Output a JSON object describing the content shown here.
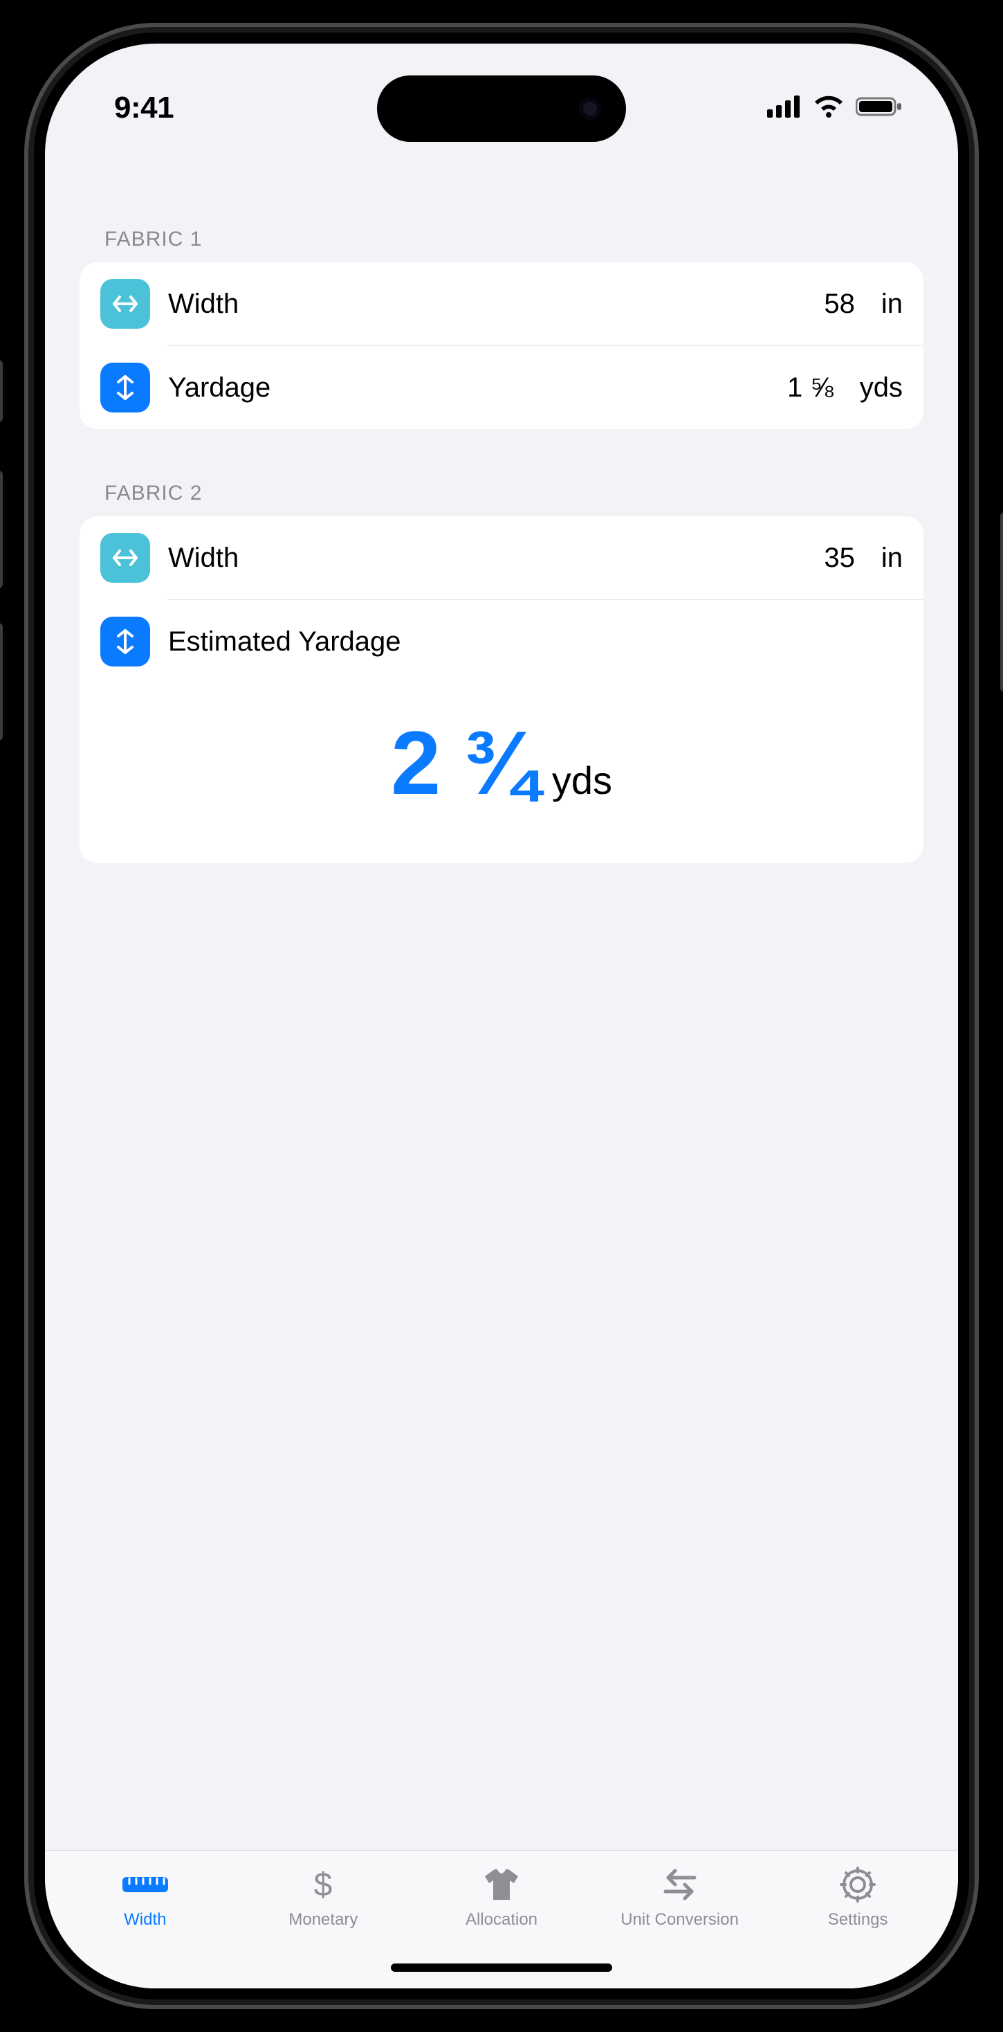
{
  "status": {
    "time": "9:41"
  },
  "sections": {
    "fabric1": {
      "title": "FABRIC 1",
      "width": {
        "label": "Width",
        "value": "58",
        "unit": "in"
      },
      "yardage": {
        "label": "Yardage",
        "value": "1 ⅝",
        "unit": "yds"
      }
    },
    "fabric2": {
      "title": "FABRIC 2",
      "width": {
        "label": "Width",
        "value": "35",
        "unit": "in"
      },
      "estimate": {
        "label": "Estimated Yardage",
        "value": "2 ¾",
        "unit": "yds"
      }
    }
  },
  "tabs": {
    "width": {
      "label": "Width",
      "active": true
    },
    "monetary": {
      "label": "Monetary",
      "active": false
    },
    "allocation": {
      "label": "Allocation",
      "active": false
    },
    "unitconv": {
      "label": "Unit Conversion",
      "active": false
    },
    "settings": {
      "label": "Settings",
      "active": false
    }
  }
}
